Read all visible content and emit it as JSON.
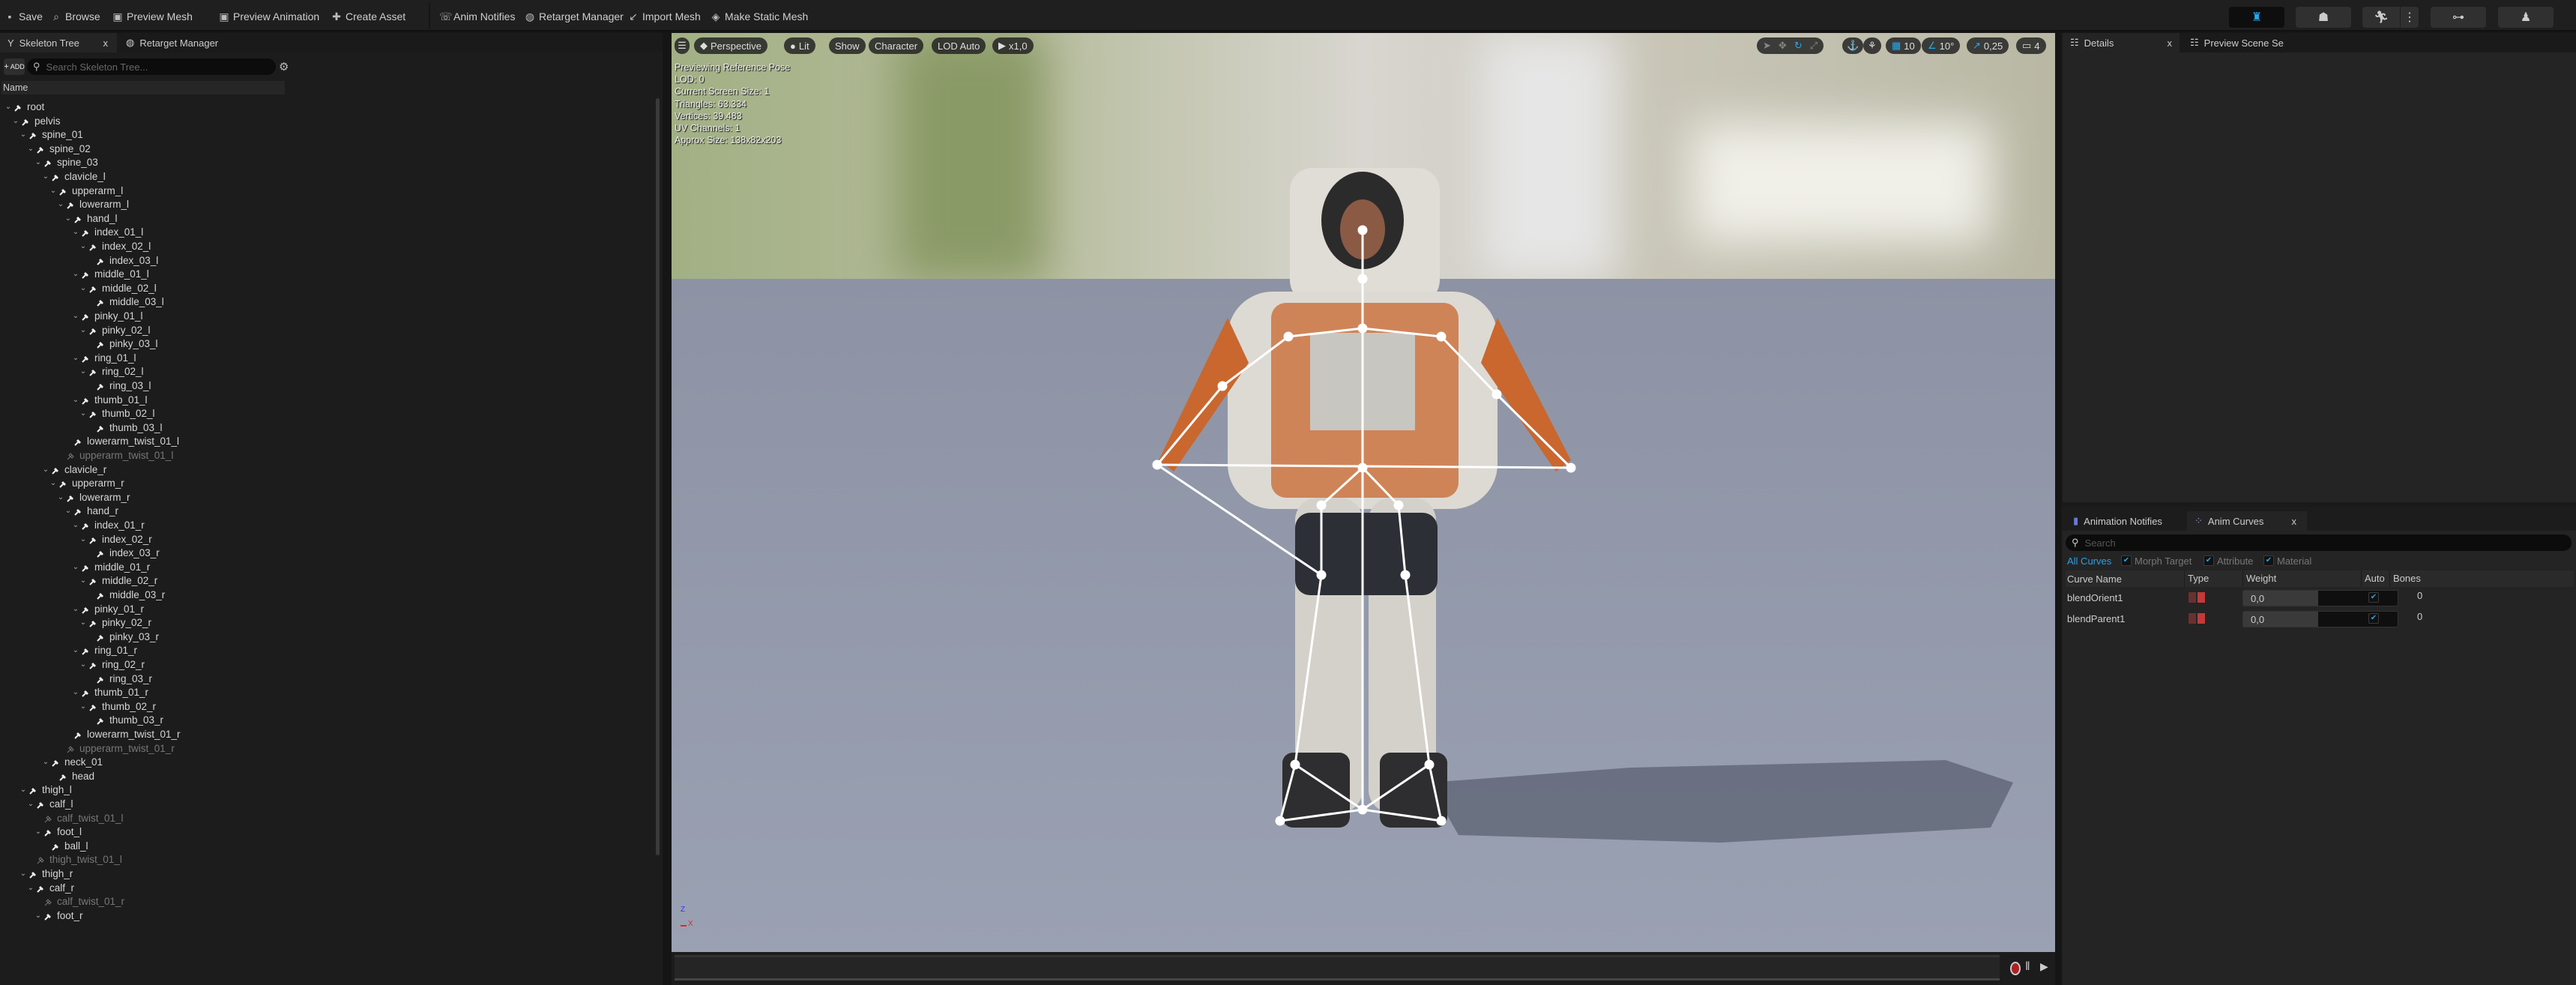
{
  "toolbar": {
    "items": [
      {
        "label": "Save",
        "icon": "save-icon"
      },
      {
        "label": "Browse",
        "icon": "browse-icon"
      },
      {
        "label": "Preview Mesh",
        "icon": "preview-mesh-icon"
      },
      {
        "label": "Preview Animation",
        "icon": "preview-animation-icon"
      },
      {
        "label": "Create Asset",
        "icon": "create-asset-icon"
      },
      {
        "label": "Anim Notifies",
        "icon": "anim-notifies-icon"
      },
      {
        "label": "Retarget Manager",
        "icon": "retarget-manager-icon"
      },
      {
        "label": "Import Mesh",
        "icon": "import-mesh-icon"
      },
      {
        "label": "Make Static Mesh",
        "icon": "make-static-mesh-icon"
      }
    ],
    "mode_buttons": [
      "skeleton-mode-icon",
      "mesh-mode-icon",
      "animation-mode-icon",
      "blueprint-mode-icon",
      "physics-mode-icon"
    ],
    "accent": "#25a9f0"
  },
  "left_panel": {
    "tabs": [
      {
        "label": "Skeleton Tree",
        "close": "x"
      },
      {
        "label": "Retarget Manager"
      }
    ],
    "add_label": "ADD",
    "search_placeholder": "Search Skeleton Tree...",
    "column_header": "Name",
    "bones": [
      {
        "name": "root",
        "depth": 0,
        "exp": true
      },
      {
        "name": "pelvis",
        "depth": 1,
        "exp": true
      },
      {
        "name": "spine_01",
        "depth": 2,
        "exp": true
      },
      {
        "name": "spine_02",
        "depth": 3,
        "exp": true
      },
      {
        "name": "spine_03",
        "depth": 4,
        "exp": true
      },
      {
        "name": "clavicle_l",
        "depth": 5,
        "exp": true
      },
      {
        "name": "upperarm_l",
        "depth": 6,
        "exp": true
      },
      {
        "name": "lowerarm_l",
        "depth": 7,
        "exp": true
      },
      {
        "name": "hand_l",
        "depth": 8,
        "exp": true
      },
      {
        "name": "index_01_l",
        "depth": 9,
        "exp": true
      },
      {
        "name": "index_02_l",
        "depth": 10,
        "exp": true
      },
      {
        "name": "index_03_l",
        "depth": 11
      },
      {
        "name": "middle_01_l",
        "depth": 9,
        "exp": true
      },
      {
        "name": "middle_02_l",
        "depth": 10,
        "exp": true
      },
      {
        "name": "middle_03_l",
        "depth": 11
      },
      {
        "name": "pinky_01_l",
        "depth": 9,
        "exp": true
      },
      {
        "name": "pinky_02_l",
        "depth": 10,
        "exp": true
      },
      {
        "name": "pinky_03_l",
        "depth": 11
      },
      {
        "name": "ring_01_l",
        "depth": 9,
        "exp": true
      },
      {
        "name": "ring_02_l",
        "depth": 10,
        "exp": true
      },
      {
        "name": "ring_03_l",
        "depth": 11
      },
      {
        "name": "thumb_01_l",
        "depth": 9,
        "exp": true
      },
      {
        "name": "thumb_02_l",
        "depth": 10,
        "exp": true
      },
      {
        "name": "thumb_03_l",
        "depth": 11
      },
      {
        "name": "lowerarm_twist_01_l",
        "depth": 8
      },
      {
        "name": "upperarm_twist_01_l",
        "depth": 7,
        "disabled": true
      },
      {
        "name": "clavicle_r",
        "depth": 5,
        "exp": true
      },
      {
        "name": "upperarm_r",
        "depth": 6,
        "exp": true
      },
      {
        "name": "lowerarm_r",
        "depth": 7,
        "exp": true
      },
      {
        "name": "hand_r",
        "depth": 8,
        "exp": true
      },
      {
        "name": "index_01_r",
        "depth": 9,
        "exp": true
      },
      {
        "name": "index_02_r",
        "depth": 10,
        "exp": true
      },
      {
        "name": "index_03_r",
        "depth": 11
      },
      {
        "name": "middle_01_r",
        "depth": 9,
        "exp": true
      },
      {
        "name": "middle_02_r",
        "depth": 10,
        "exp": true
      },
      {
        "name": "middle_03_r",
        "depth": 11
      },
      {
        "name": "pinky_01_r",
        "depth": 9,
        "exp": true
      },
      {
        "name": "pinky_02_r",
        "depth": 10,
        "exp": true
      },
      {
        "name": "pinky_03_r",
        "depth": 11
      },
      {
        "name": "ring_01_r",
        "depth": 9,
        "exp": true
      },
      {
        "name": "ring_02_r",
        "depth": 10,
        "exp": true
      },
      {
        "name": "ring_03_r",
        "depth": 11
      },
      {
        "name": "thumb_01_r",
        "depth": 9,
        "exp": true
      },
      {
        "name": "thumb_02_r",
        "depth": 10,
        "exp": true
      },
      {
        "name": "thumb_03_r",
        "depth": 11
      },
      {
        "name": "lowerarm_twist_01_r",
        "depth": 8
      },
      {
        "name": "upperarm_twist_01_r",
        "depth": 7,
        "disabled": true
      },
      {
        "name": "neck_01",
        "depth": 5,
        "exp": true
      },
      {
        "name": "head",
        "depth": 6
      },
      {
        "name": "thigh_l",
        "depth": 2,
        "exp": true
      },
      {
        "name": "calf_l",
        "depth": 3,
        "exp": true
      },
      {
        "name": "calf_twist_01_l",
        "depth": 4,
        "disabled": true
      },
      {
        "name": "foot_l",
        "depth": 4,
        "exp": true
      },
      {
        "name": "ball_l",
        "depth": 5
      },
      {
        "name": "thigh_twist_01_l",
        "depth": 3,
        "disabled": true
      },
      {
        "name": "thigh_r",
        "depth": 2,
        "exp": true
      },
      {
        "name": "calf_r",
        "depth": 3,
        "exp": true
      },
      {
        "name": "calf_twist_01_r",
        "depth": 4,
        "disabled": true
      },
      {
        "name": "foot_r",
        "depth": 4,
        "exp": true
      }
    ]
  },
  "viewport": {
    "pills": {
      "perspective": "Perspective",
      "lit": "Lit",
      "show": "Show",
      "character": "Character",
      "lod": "LOD Auto",
      "speed": "x1,0"
    },
    "info": [
      "Previewing Reference Pose",
      "LOD: 0",
      "Current Screen Size: 1",
      "Triangles: 63.334",
      "Vertices: 39.483",
      "UV Channels: 1",
      "Approx Size: 138x82x203"
    ],
    "grid_snap": "10",
    "rotate_snap": "10°",
    "scale_snap": "0,25",
    "camera_speed": "4",
    "axis": {
      "z": "Z",
      "x": "X"
    }
  },
  "details_panel": {
    "tabs": [
      {
        "label": "Details",
        "close": "x"
      },
      {
        "label": "Preview Scene Se"
      }
    ]
  },
  "curves_panel": {
    "tabs": [
      {
        "label": "Animation Notifies"
      },
      {
        "label": "Anim Curves",
        "close": "x"
      }
    ],
    "search_placeholder": "Search",
    "filters": {
      "all": "All Curves",
      "morph": "Morph Target",
      "attribute": "Attribute",
      "material": "Material"
    },
    "columns": [
      "Curve Name",
      "Type",
      "Weight",
      "Auto",
      "Bones"
    ],
    "rows": [
      {
        "name": "blendOrient1",
        "weight": "0,0",
        "auto": true,
        "bones": "0"
      },
      {
        "name": "blendParent1",
        "weight": "0,0",
        "auto": true,
        "bones": "0"
      }
    ]
  }
}
